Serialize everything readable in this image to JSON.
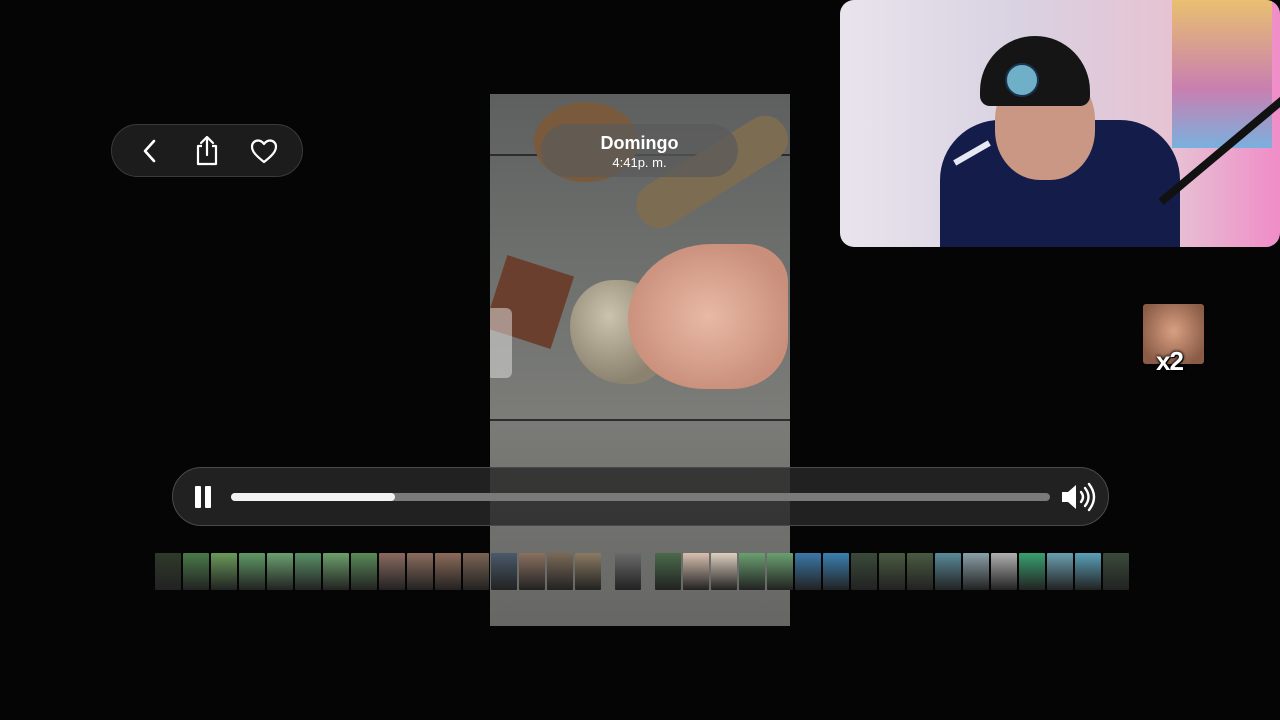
{
  "date_pill": {
    "day": "Domingo",
    "time": "4:41p. m."
  },
  "toolbar": {
    "back": {
      "icon": "chevron-left-icon"
    },
    "share": {
      "icon": "share-icon"
    },
    "favorite": {
      "icon": "heart-icon"
    }
  },
  "player": {
    "state": "playing",
    "pause_icon": "pause-icon",
    "volume_icon": "speaker-wave-icon",
    "progress": 0.2
  },
  "overlay": {
    "emote_count": "x2"
  },
  "filmstrip": {
    "thumbnails": [
      "#2f3a2a",
      "#4a7a4a",
      "#6a9a5a",
      "#5f9a66",
      "#6aa070",
      "#5a9068",
      "#6c9f6a",
      "#5a8a58",
      "#8a6a60",
      "#8a6c5e",
      "#8c6a5a",
      "#7a6454",
      "#4a5a6a",
      "#8a7060",
      "#7a6a58",
      "#8a7a62",
      "#gap",
      "#6a6a6a",
      "#gap",
      "#4a6a4a",
      "#d8c0b0",
      "#ded0c0",
      "#6aa070",
      "#6aa070",
      "#3a78a8",
      "#3a80b0",
      "#3a4a3a",
      "#4a5a40",
      "#4a5a40",
      "#5a8a9a",
      "#8aa0a8",
      "#b0b0b0",
      "#3aa070",
      "#6aa0b0",
      "#5aa0b8",
      "#3a4a3a"
    ]
  }
}
